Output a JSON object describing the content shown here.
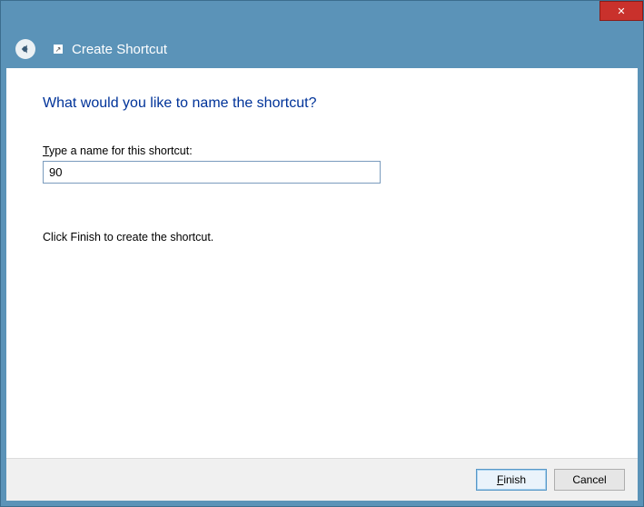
{
  "window": {
    "close_glyph": "✕"
  },
  "header": {
    "title": "Create Shortcut",
    "shortcut_glyph": "↗"
  },
  "main": {
    "heading": "What would you like to name the shortcut?",
    "label_prefix_underlined": "T",
    "label_rest": "ype a name for this shortcut:",
    "input_value": "90",
    "helper_text": "Click Finish to create the shortcut."
  },
  "buttons": {
    "finish_prefix_underlined": "F",
    "finish_rest": "inish",
    "cancel_label": "Cancel"
  }
}
